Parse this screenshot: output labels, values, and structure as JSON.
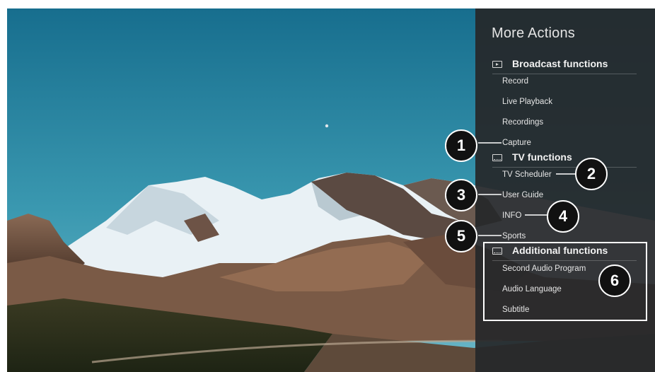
{
  "panel": {
    "title": "More Actions",
    "sections": [
      {
        "label": "Broadcast functions",
        "icon": "play-icon",
        "items": [
          "Record",
          "Live Playback",
          "Recordings",
          "Capture"
        ]
      },
      {
        "label": "TV functions",
        "icon": "tv-icon",
        "items": [
          "TV Scheduler",
          "User Guide",
          "INFO",
          "Sports"
        ]
      },
      {
        "label": "Additional functions",
        "icon": "tv-icon",
        "items": [
          "Second Audio Program",
          "Audio Language",
          "Subtitle"
        ]
      }
    ]
  },
  "callouts": [
    "1",
    "2",
    "3",
    "4",
    "5",
    "6"
  ],
  "colors": {
    "panel_bg": "#26282a",
    "sky": "#1f8aa6",
    "callout_bg": "#111111"
  }
}
